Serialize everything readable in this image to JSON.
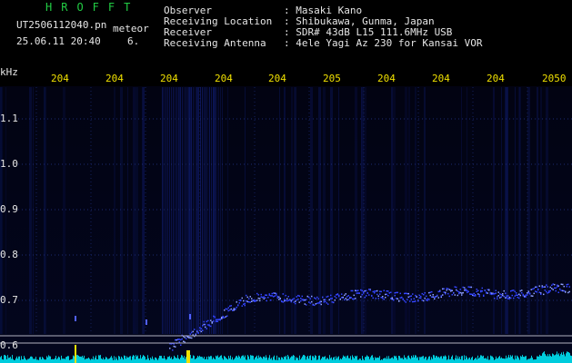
{
  "header": {
    "brand": "HROFFT",
    "filename": "UT2506112040.pn",
    "mode": "meteor",
    "datetime": "25.06.11 20:40",
    "page": "6."
  },
  "info": [
    {
      "label": "Observer",
      "value": ": Masaki Kano"
    },
    {
      "label": "Receiving Location",
      "value": ": Shibukawa, Gunma, Japan"
    },
    {
      "label": "Receiver",
      "value": ": SDR# 43dB L15 111.6MHz USB"
    },
    {
      "label": "Receiving Antenna",
      "value": ": 4ele Yagi Az 230 for Kansai VOR"
    }
  ],
  "axis": {
    "unit": "kHz",
    "x_ticks": [
      "204",
      "204",
      "204",
      "204",
      "204",
      "205",
      "204",
      "204",
      "204",
      "204",
      "2050"
    ],
    "y_ticks": [
      "1.1",
      "1.0",
      "0.9",
      "0.8",
      "0.7",
      "0.6"
    ]
  },
  "colors": {
    "background": "#000000",
    "header_text": "#e6e6e6",
    "brand": "#22cc44",
    "ticks": "#f0e000",
    "signal": "#3344ff",
    "noise_floor": "#00ccdd"
  }
}
